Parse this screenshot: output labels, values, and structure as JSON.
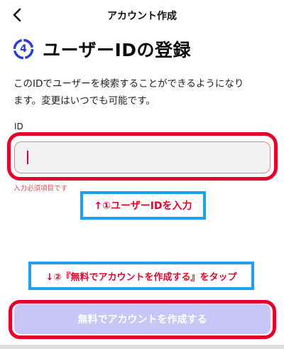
{
  "header": {
    "title": "アカウント作成",
    "back_icon": "chevron-left-icon"
  },
  "step": {
    "number": "4",
    "title": "ユーザーIDの登録",
    "badge_color": "#2c3ad6"
  },
  "description": {
    "line1": "このIDでユーザーを検索することができるようになり",
    "line2": "ます。変更はいつでも可能です。"
  },
  "form": {
    "id_label": "ID",
    "id_value": "",
    "error": "入力必須項目です"
  },
  "annotations": {
    "note1": "↑①ユーザーIDを入力",
    "note2": "↓②『無料でアカウントを作成する』をタップ",
    "highlight_color": "#e5002a",
    "note_border_color": "#1ea0f0"
  },
  "footer": {
    "submit_label": "無料でアカウントを作成する",
    "submit_color": "#c8c5f7"
  }
}
